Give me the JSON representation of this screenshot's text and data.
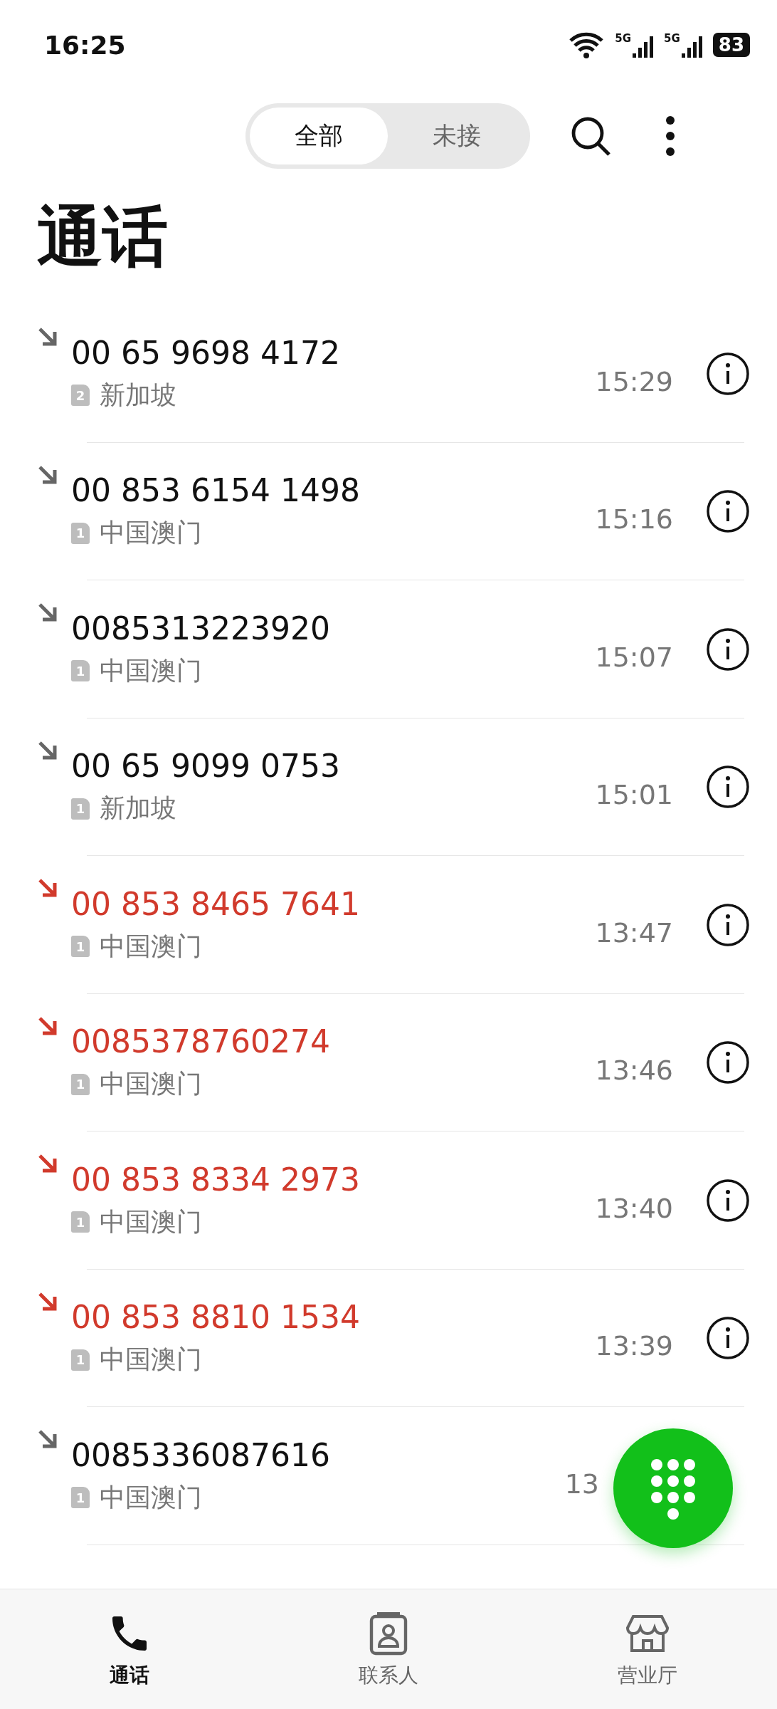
{
  "status_bar": {
    "time": "16:25",
    "sim_1": "5G",
    "sim_2": "5G",
    "battery": "83"
  },
  "filter_tabs": [
    {
      "label": "全部",
      "selected": true
    },
    {
      "label": "未接",
      "selected": false
    }
  ],
  "title": "通话",
  "calls": [
    {
      "number": "00 65 9698 4172",
      "kind": "incoming",
      "sim": "2",
      "location": "新加坡",
      "time": "15:29"
    },
    {
      "number": "00 853 6154 1498",
      "kind": "incoming",
      "sim": "1",
      "location": "中国澳门",
      "time": "15:16"
    },
    {
      "number": "0085313223920",
      "kind": "incoming",
      "sim": "1",
      "location": "中国澳门",
      "time": "15:07"
    },
    {
      "number": "00 65 9099 0753",
      "kind": "incoming",
      "sim": "1",
      "location": "新加坡",
      "time": "15:01"
    },
    {
      "number": "00 853 8465 7641",
      "kind": "missed",
      "sim": "1",
      "location": "中国澳门",
      "time": "13:47"
    },
    {
      "number": "0085378760274",
      "kind": "missed",
      "sim": "1",
      "location": "中国澳门",
      "time": "13:46"
    },
    {
      "number": "00 853 8334 2973",
      "kind": "missed",
      "sim": "1",
      "location": "中国澳门",
      "time": "13:40"
    },
    {
      "number": "00 853 8810 1534",
      "kind": "missed",
      "sim": "1",
      "location": "中国澳门",
      "time": "13:39"
    },
    {
      "number": "0085336087616",
      "kind": "incoming",
      "sim": "1",
      "location": "中国澳门",
      "time": "13"
    }
  ],
  "bottom_nav": [
    {
      "label": "通话",
      "selected": true
    },
    {
      "label": "联系人",
      "selected": false
    },
    {
      "label": "营业厅",
      "selected": false
    }
  ]
}
